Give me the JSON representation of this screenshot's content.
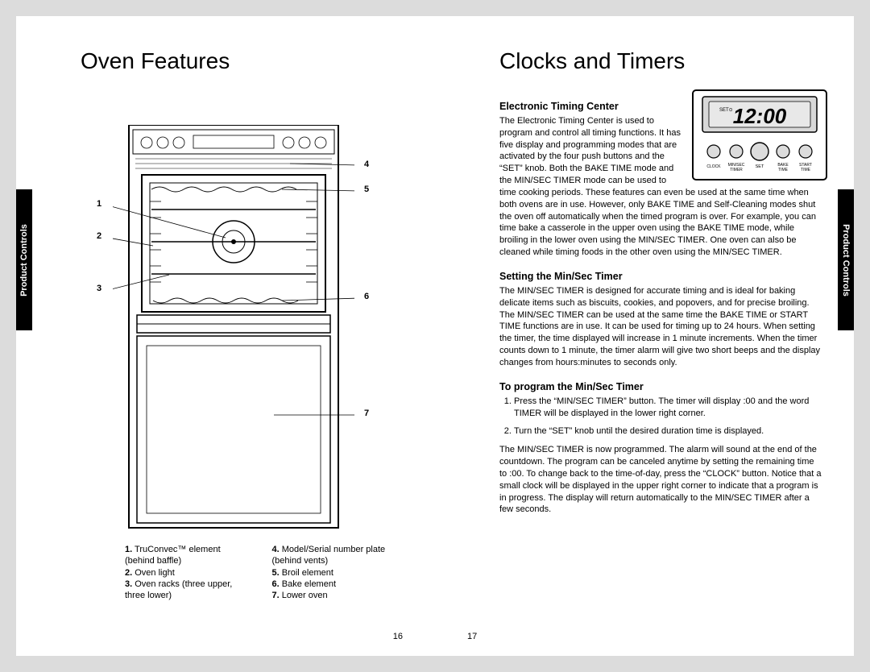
{
  "left": {
    "title": "Oven Features",
    "tab": "Product Controls",
    "page_number": "16",
    "callouts": {
      "n1": "1",
      "n2": "2",
      "n3": "3",
      "n4": "4",
      "n5": "5",
      "n6": "6",
      "n7": "7"
    },
    "legend": [
      {
        "n": "1.",
        "t": "TruConvec™ element (behind baffle)"
      },
      {
        "n": "2.",
        "t": "Oven light"
      },
      {
        "n": "3.",
        "t": "Oven racks (three upper, three lower)"
      },
      {
        "n": "4.",
        "t": "Model/Serial number plate (behind vents)"
      },
      {
        "n": "5.",
        "t": "Broil element"
      },
      {
        "n": "6.",
        "t": "Bake element"
      },
      {
        "n": "7.",
        "t": "Lower oven"
      }
    ]
  },
  "right": {
    "title": "Clocks and Timers",
    "tab": "Product Controls",
    "page_number": "17",
    "etc": {
      "time": "12:00",
      "set_label": "SET",
      "buttons": [
        "CLOCK",
        "MIN/SEC TIMER",
        "SET",
        "BAKE TIME",
        "START TIME"
      ]
    },
    "h_etc": "Electronic Timing Center",
    "p_etc": "The Electronic Timing Center is used to program and control all timing functions. It has five display and programming modes that are activated by the four push buttons and the “SET” knob. Both the BAKE TIME mode and the MIN/SEC TIMER mode can be used to time cooking periods. These features can even be used at the same time when both ovens are in use. However, only BAKE TIME and Self-Cleaning modes shut the oven off automatically when the timed program is over. For example, you can time bake a casserole in the upper oven using the BAKE TIME mode, while broiling in the lower oven using the MIN/SEC TIMER. One oven can also be cleaned while timing foods in the other oven using the MIN/SEC TIMER.",
    "h_set": "Setting the Min/Sec Timer",
    "p_set": "The MIN/SEC TIMER is designed for accurate timing and is ideal for baking delicate items such as biscuits, cookies, and popovers, and for precise broiling. The MIN/SEC TIMER can be used at the same time the BAKE TIME or START TIME functions are in use. It can be used for timing up to 24 hours. When setting the timer, the time displayed will increase in 1 minute increments. When the timer counts down to 1 minute, the timer alarm will give two short beeps and the display changes from hours:minutes to seconds only.",
    "h_prog": "To program the Min/Sec Timer",
    "step1": "Press the “MIN/SEC TIMER” button. The timer will display :00 and the word TIMER will be displayed in the lower right corner.",
    "step2": "Turn the “SET” knob until the desired duration time is displayed.",
    "p_after": "The MIN/SEC TIMER is now programmed. The alarm will sound at the end of the countdown. The program can be canceled anytime by setting the remaining time to :00. To change back to the time-of-day, press the “CLOCK” button. Notice that a small clock will be displayed in the upper right corner to indicate that a program is in progress. The display will return automatically to the MIN/SEC TIMER after a few seconds."
  }
}
